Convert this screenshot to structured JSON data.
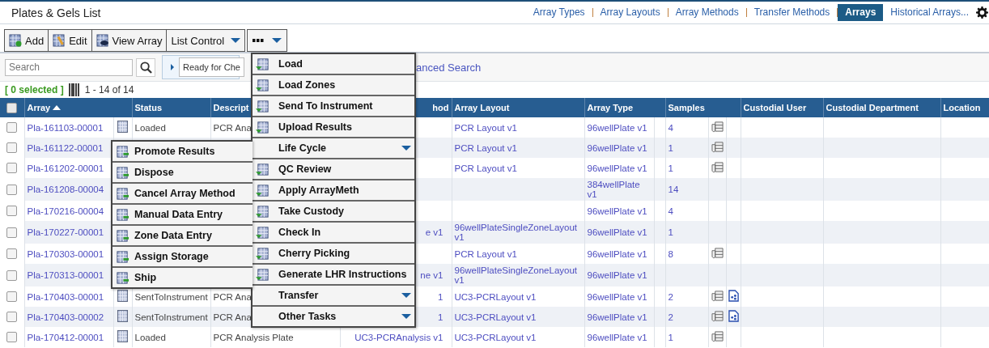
{
  "page": {
    "title": "Plates & Gels List"
  },
  "nav": [
    {
      "label": "Array Types",
      "selected": false
    },
    {
      "label": "Array Layouts",
      "selected": false
    },
    {
      "label": "Array Methods",
      "selected": false
    },
    {
      "label": "Transfer Methods",
      "selected": false
    },
    {
      "label": "Arrays",
      "selected": true
    },
    {
      "label": "Historical Arrays...",
      "selected": false
    }
  ],
  "toolbar": [
    {
      "label": "Add",
      "kind": "add"
    },
    {
      "label": "Edit",
      "kind": "edit"
    },
    {
      "label": "View Array",
      "kind": "view"
    },
    {
      "label": "List Control",
      "kind": "dropdown"
    }
  ],
  "search": {
    "placeholder": "Search",
    "filter_value": "Ready for Che",
    "advanced_link": "anced Search"
  },
  "selection": {
    "selected_text": "[ 0 selected ]",
    "range": "1 - 14 of 14"
  },
  "table": {
    "select_all_checked": false,
    "columns": [
      {
        "label": "Array",
        "sorted": true
      },
      {
        "label": "Status",
        "sorted": false
      },
      {
        "label": "Descript",
        "sorted": false
      },
      {
        "label": "hod",
        "sorted": false
      },
      {
        "label": "Array Layout",
        "sorted": false
      },
      {
        "label": "Array Type",
        "sorted": false
      },
      {
        "label": "Samples",
        "sorted": false
      },
      {
        "label": "Custodial User",
        "sorted": false
      },
      {
        "label": "Custodial Department",
        "sorted": false
      },
      {
        "label": "Location",
        "sorted": false
      }
    ],
    "rows": [
      {
        "checked": false,
        "array": "Pla-161103-00001",
        "status_icon": true,
        "status": "Loaded",
        "description": "PCR Ana",
        "layout": "PCR Layout v1",
        "type": "96wellPlate v1",
        "samples": "4",
        "rack_icon": true,
        "file_icon": false
      },
      {
        "checked": false,
        "array": "Pla-161122-00001",
        "status_icon": false,
        "layout": "PCR Layout v1",
        "type": "96wellPlate v1",
        "samples": "1",
        "rack_icon": true,
        "file_icon": false
      },
      {
        "checked": false,
        "array": "Pla-161202-00001",
        "status_icon": false,
        "layout": "PCR Layout v1",
        "type": "96wellPlate v1",
        "samples": "1",
        "rack_icon": true,
        "file_icon": false
      },
      {
        "checked": false,
        "array": "Pla-161208-00004",
        "status_icon": false,
        "type": "384wellPlate v1",
        "samples": "14",
        "rack_icon": false,
        "file_icon": false
      },
      {
        "checked": false,
        "array": "Pla-170216-00004",
        "status_icon": false,
        "type": "96wellPlate v1",
        "samples": "4",
        "rack_icon": false,
        "file_icon": false
      },
      {
        "checked": false,
        "array": "Pla-170227-00001",
        "status_icon": false,
        "method": "e v1",
        "layout": "96wellPlateSingleZoneLayout v1",
        "type": "96wellPlate v1",
        "samples": "1",
        "rack_icon": false,
        "file_icon": false
      },
      {
        "checked": false,
        "array": "Pla-170303-00001",
        "status_icon": false,
        "layout": "PCR Layout v1",
        "type": "96wellPlate v1",
        "samples": "8",
        "rack_icon": true,
        "file_icon": false
      },
      {
        "checked": false,
        "array": "Pla-170313-00001",
        "status_icon": false,
        "method": "ne v1",
        "layout": "96wellPlateSingleZoneLayout v1",
        "type": "96wellPlate v1",
        "rack_icon": false,
        "file_icon": false
      },
      {
        "checked": false,
        "array": "Pla-170403-00001",
        "status_icon": true,
        "status": "SentToInstrument",
        "description": "PCR Ana",
        "method": "1",
        "layout": "UC3-PCRLayout v1",
        "type": "96wellPlate v1",
        "samples": "2",
        "rack_icon": true,
        "file_icon": true
      },
      {
        "checked": false,
        "array": "Pla-170403-00002",
        "status_icon": true,
        "status": "SentToInstrument",
        "description": "PCR Ana",
        "method": "1",
        "layout": "UC3-PCRLayout v1",
        "type": "96wellPlate v1",
        "samples": "2",
        "rack_icon": true,
        "file_icon": true
      },
      {
        "checked": false,
        "array": "Pla-170412-00001",
        "status_icon": true,
        "status": "Loaded",
        "description": "PCR Analysis Plate",
        "method": "UC3-PCRAnalysis v1",
        "layout": "UC3-PCRLayout v1",
        "type": "96wellPlate v1",
        "samples": "1",
        "rack_icon": true,
        "file_icon": false
      }
    ]
  },
  "menu": [
    {
      "label": "Load",
      "kind": "action"
    },
    {
      "label": "Load Zones",
      "kind": "action"
    },
    {
      "label": "Send To Instrument",
      "kind": "action"
    },
    {
      "label": "Upload Results",
      "kind": "action"
    },
    {
      "label": "Life Cycle",
      "kind": "submenu"
    },
    {
      "label": "QC Review",
      "kind": "action"
    },
    {
      "label": "Apply ArrayMeth",
      "kind": "action"
    },
    {
      "label": "Take Custody",
      "kind": "action"
    },
    {
      "label": "Check In",
      "kind": "action"
    },
    {
      "label": "Cherry Picking",
      "kind": "action"
    },
    {
      "label": "Generate LHR Instructions",
      "kind": "action"
    },
    {
      "label": "Transfer",
      "kind": "submenu"
    },
    {
      "label": "Other Tasks",
      "kind": "submenu"
    }
  ],
  "submenu": [
    {
      "label": "Promote Results"
    },
    {
      "label": "Dispose"
    },
    {
      "label": "Cancel Array Method"
    },
    {
      "label": "Manual Data Entry"
    },
    {
      "label": "Zone Data Entry"
    },
    {
      "label": "Assign Storage"
    },
    {
      "label": "Ship"
    }
  ]
}
